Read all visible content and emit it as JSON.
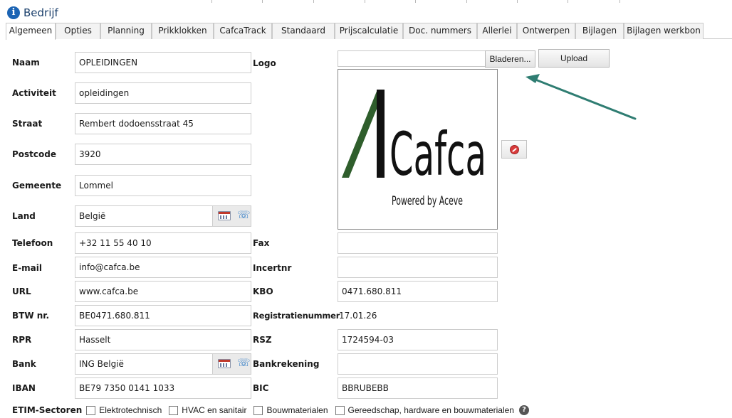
{
  "window": {
    "title": "Bedrijf"
  },
  "tabs": [
    {
      "label": "Algemeen",
      "active": true
    },
    {
      "label": "Opties"
    },
    {
      "label": "Planning"
    },
    {
      "label": "Prikklokken"
    },
    {
      "label": "CafcaTrack"
    },
    {
      "label": "Standaard"
    },
    {
      "label": "Prijscalculatie"
    },
    {
      "label": "Doc. nummers"
    },
    {
      "label": "Allerlei"
    },
    {
      "label": "Ontwerpen"
    },
    {
      "label": "Bijlagen"
    },
    {
      "label": "Bijlagen werkbon"
    }
  ],
  "left_fields": {
    "naam": {
      "label": "Naam",
      "value": "OPLEIDINGEN"
    },
    "activiteit": {
      "label": "Activiteit",
      "value": "opleidingen"
    },
    "straat": {
      "label": "Straat",
      "value": "Rembert dodoensstraat 45"
    },
    "postcode": {
      "label": "Postcode",
      "value": "3920"
    },
    "gemeente": {
      "label": "Gemeente",
      "value": "Lommel"
    },
    "land": {
      "label": "Land",
      "value": "België"
    },
    "telefoon": {
      "label": "Telefoon",
      "value": "+32 11 55 40 10"
    },
    "email": {
      "label": "E-mail",
      "value": "info@cafca.be"
    },
    "url": {
      "label": "URL",
      "value": "www.cafca.be"
    },
    "btw": {
      "label": "BTW nr.",
      "value": "BE0471.680.811"
    },
    "rpr": {
      "label": "RPR",
      "value": "Hasselt"
    },
    "bank": {
      "label": "Bank",
      "value": "ING België"
    },
    "iban": {
      "label": "IBAN",
      "value": "BE79 7350 0141 1033"
    }
  },
  "right_fields": {
    "logo": {
      "label": "Logo"
    },
    "fax": {
      "label": "Fax",
      "value": ""
    },
    "incertnr": {
      "label": "Incertnr",
      "value": ""
    },
    "kbo": {
      "label": "KBO",
      "value": "0471.680.811"
    },
    "registratienummer": {
      "label": "Registratienummer",
      "value": "17.01.26"
    },
    "rsz": {
      "label": "RSZ",
      "value": "1724594-03"
    },
    "bankrekening": {
      "label": "Bankrekening",
      "value": ""
    },
    "bic": {
      "label": "BIC",
      "value": "BBRUBEBB"
    }
  },
  "logo_controls": {
    "browse_label": "Bladeren...",
    "upload_label": "Upload"
  },
  "logo_image": {
    "brand": "Cafca",
    "tagline": "Powered by Aceve",
    "mark_color": "#2f5e2c",
    "text_color": "#111111"
  },
  "etim": {
    "label": "ETIM-Sectoren",
    "options": [
      {
        "label": "Elektrotechnisch",
        "checked": false
      },
      {
        "label": "HVAC en sanitair",
        "checked": false
      },
      {
        "label": "Bouwmaterialen",
        "checked": false
      },
      {
        "label": "Gereedschap, hardware en bouwmaterialen",
        "checked": false
      }
    ]
  },
  "icons": {
    "info": "info-icon",
    "calendar": "calendar-icon",
    "phone": "phone-icon",
    "delete": "delete-icon",
    "help": "help-icon"
  },
  "colors": {
    "accent": "#1c64b4",
    "annotation_arrow": "#2f7d72",
    "delete_red": "#d93b3b"
  }
}
